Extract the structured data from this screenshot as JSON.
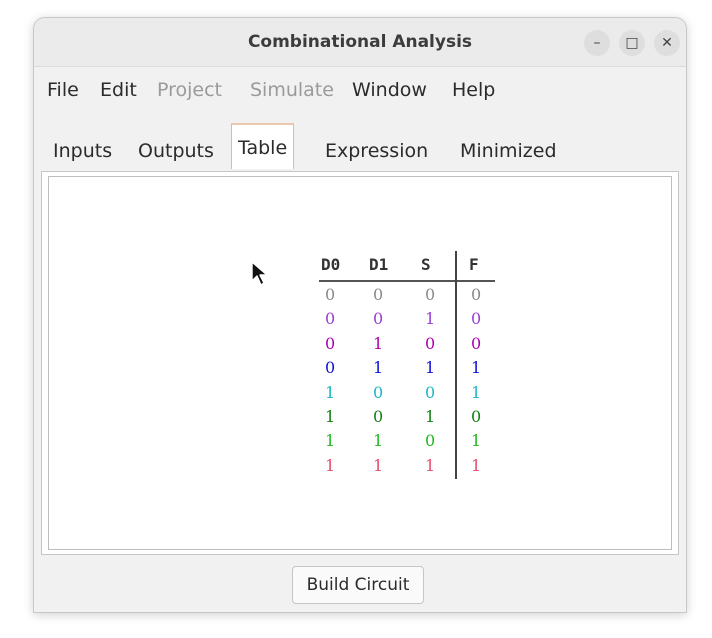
{
  "window": {
    "title": "Combinational Analysis",
    "controls": {
      "minimize": "–",
      "maximize": "□",
      "close": "✕"
    }
  },
  "menu": [
    "File",
    "Edit",
    "Project",
    "Simulate",
    "Window",
    "Help"
  ],
  "menu_disabled": [
    "Project",
    "Simulate"
  ],
  "tabs": [
    "Inputs",
    "Outputs",
    "Table",
    "Expression",
    "Minimized"
  ],
  "active_tab": "Table",
  "truth_table": {
    "headers": [
      "D0",
      "D1",
      "S",
      "F"
    ],
    "rows": [
      [
        "0",
        "0",
        "0",
        "0"
      ],
      [
        "0",
        "0",
        "1",
        "0"
      ],
      [
        "0",
        "1",
        "0",
        "0"
      ],
      [
        "0",
        "1",
        "1",
        "1"
      ],
      [
        "1",
        "0",
        "0",
        "1"
      ],
      [
        "1",
        "0",
        "1",
        "0"
      ],
      [
        "1",
        "1",
        "0",
        "1"
      ],
      [
        "1",
        "1",
        "1",
        "1"
      ]
    ],
    "row_colors": [
      "#8a8a8a",
      "#9a3fd4",
      "#b000b0",
      "#1010d8",
      "#19b8c4",
      "#138013",
      "#22b822",
      "#e84c6c"
    ]
  },
  "build_button": "Build Circuit"
}
